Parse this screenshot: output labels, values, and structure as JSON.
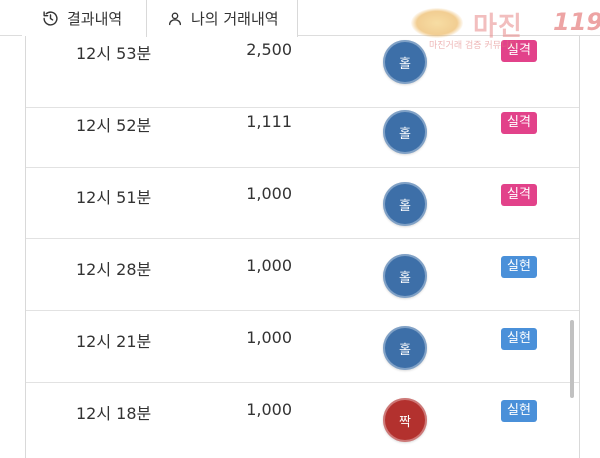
{
  "tabs": [
    {
      "label": "결과내역",
      "icon": "history-icon",
      "active": false
    },
    {
      "label": "나의 거래내역",
      "icon": "person-icon",
      "active": true
    }
  ],
  "watermark": {
    "name": "마진",
    "number": "119",
    "tagline": "마진거래 검증 커뮤니티"
  },
  "colors": {
    "odd": "#3d6fa8",
    "even": "#b3312e",
    "fail": "#e2428a",
    "success": "#4a90d9"
  },
  "rows": [
    {
      "time": "12시 53분",
      "amount": "2,500",
      "pick": "홀",
      "pick_type": "odd",
      "result": "실격",
      "result_type": "fail"
    },
    {
      "time": "12시 52분",
      "amount": "1,111",
      "pick": "홀",
      "pick_type": "odd",
      "result": "실격",
      "result_type": "fail"
    },
    {
      "time": "12시 51분",
      "amount": "1,000",
      "pick": "홀",
      "pick_type": "odd",
      "result": "실격",
      "result_type": "fail"
    },
    {
      "time": "12시 28분",
      "amount": "1,000",
      "pick": "홀",
      "pick_type": "odd",
      "result": "실현",
      "result_type": "success"
    },
    {
      "time": "12시 21분",
      "amount": "1,000",
      "pick": "홀",
      "pick_type": "odd",
      "result": "실현",
      "result_type": "success"
    },
    {
      "time": "12시 18분",
      "amount": "1,000",
      "pick": "짝",
      "pick_type": "even",
      "result": "실현",
      "result_type": "success"
    }
  ]
}
